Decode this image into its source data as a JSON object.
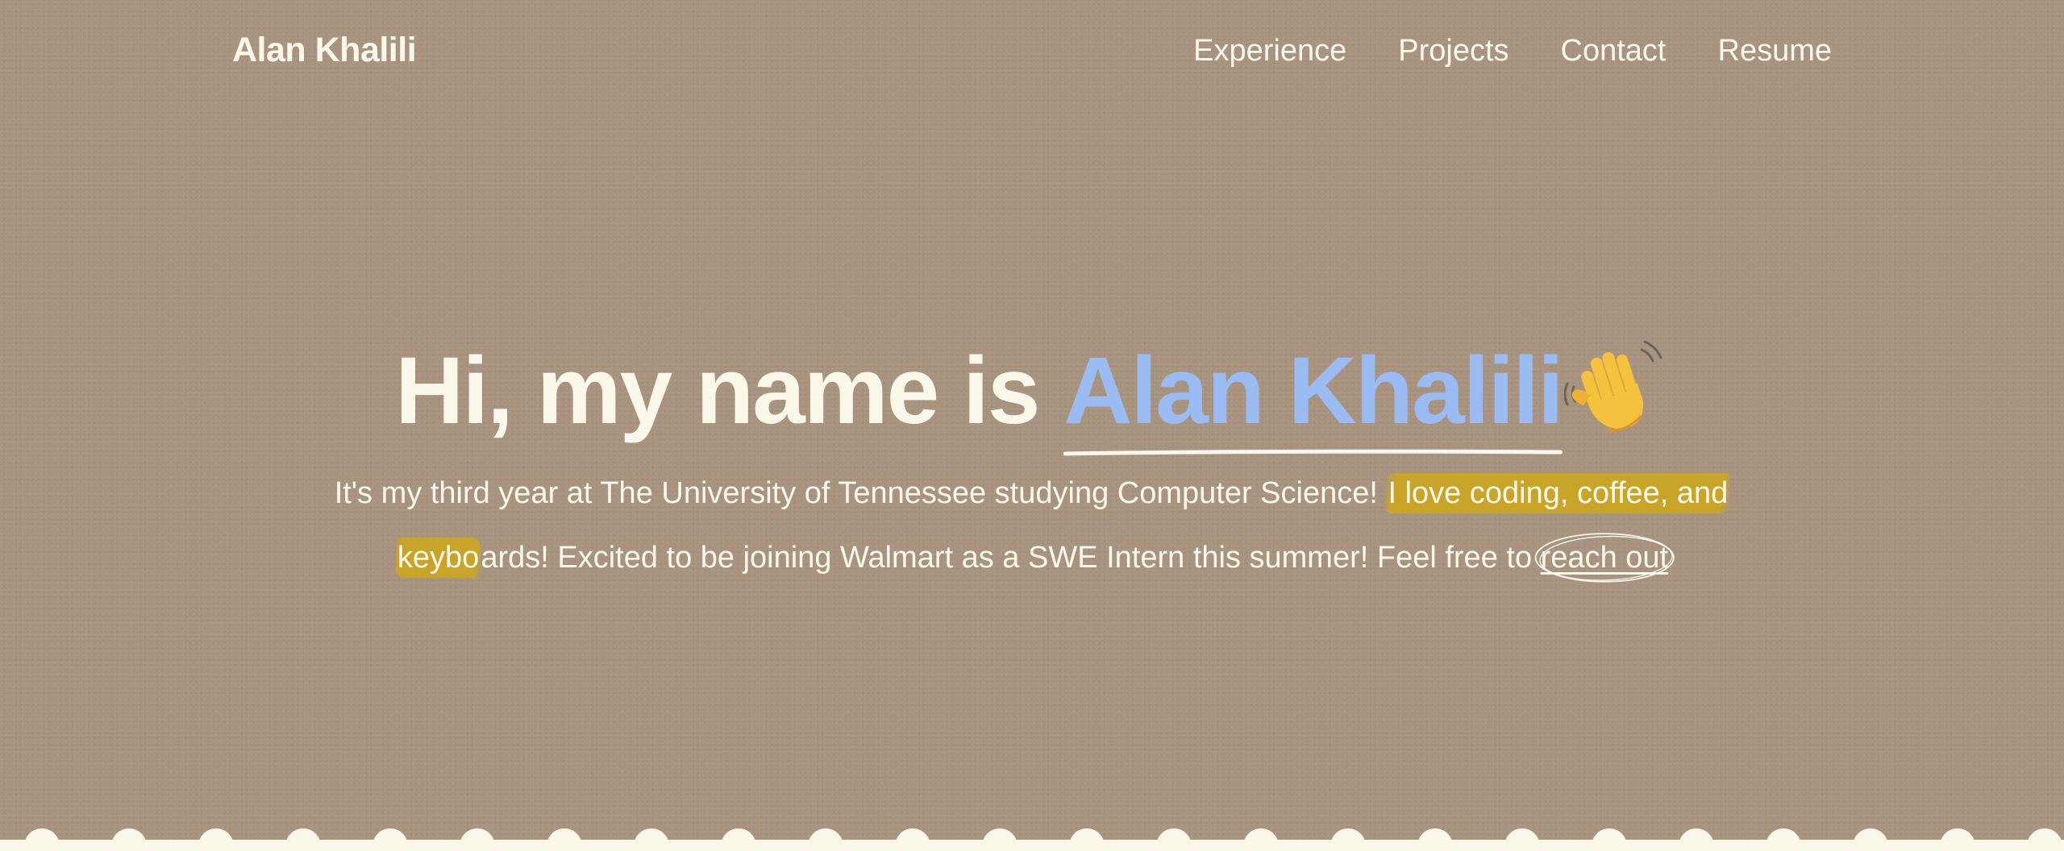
{
  "nav": {
    "brand": "Alan Khalili",
    "links": [
      "Experience",
      "Projects",
      "Contact",
      "Resume"
    ]
  },
  "hero": {
    "title_prefix": "Hi, my name is ",
    "title_name": "Alan Khalili",
    "description_part1": "It's my third year at The University of Tennessee studying Computer Science! ",
    "description_highlight1": "I love coding, coffee, and",
    "description_highlight2": "keybo",
    "description_part2": "ards! Excited to be joining Walmart as a SWE Intern this summer! Feel free to ",
    "reach_out": "reach out"
  },
  "icons": {
    "wave": "waving-hand-icon"
  },
  "colors": {
    "background": "#a8937f",
    "text": "#fbf8ea",
    "name_accent": "#9bbcf2",
    "highlighter": "#cda819"
  }
}
